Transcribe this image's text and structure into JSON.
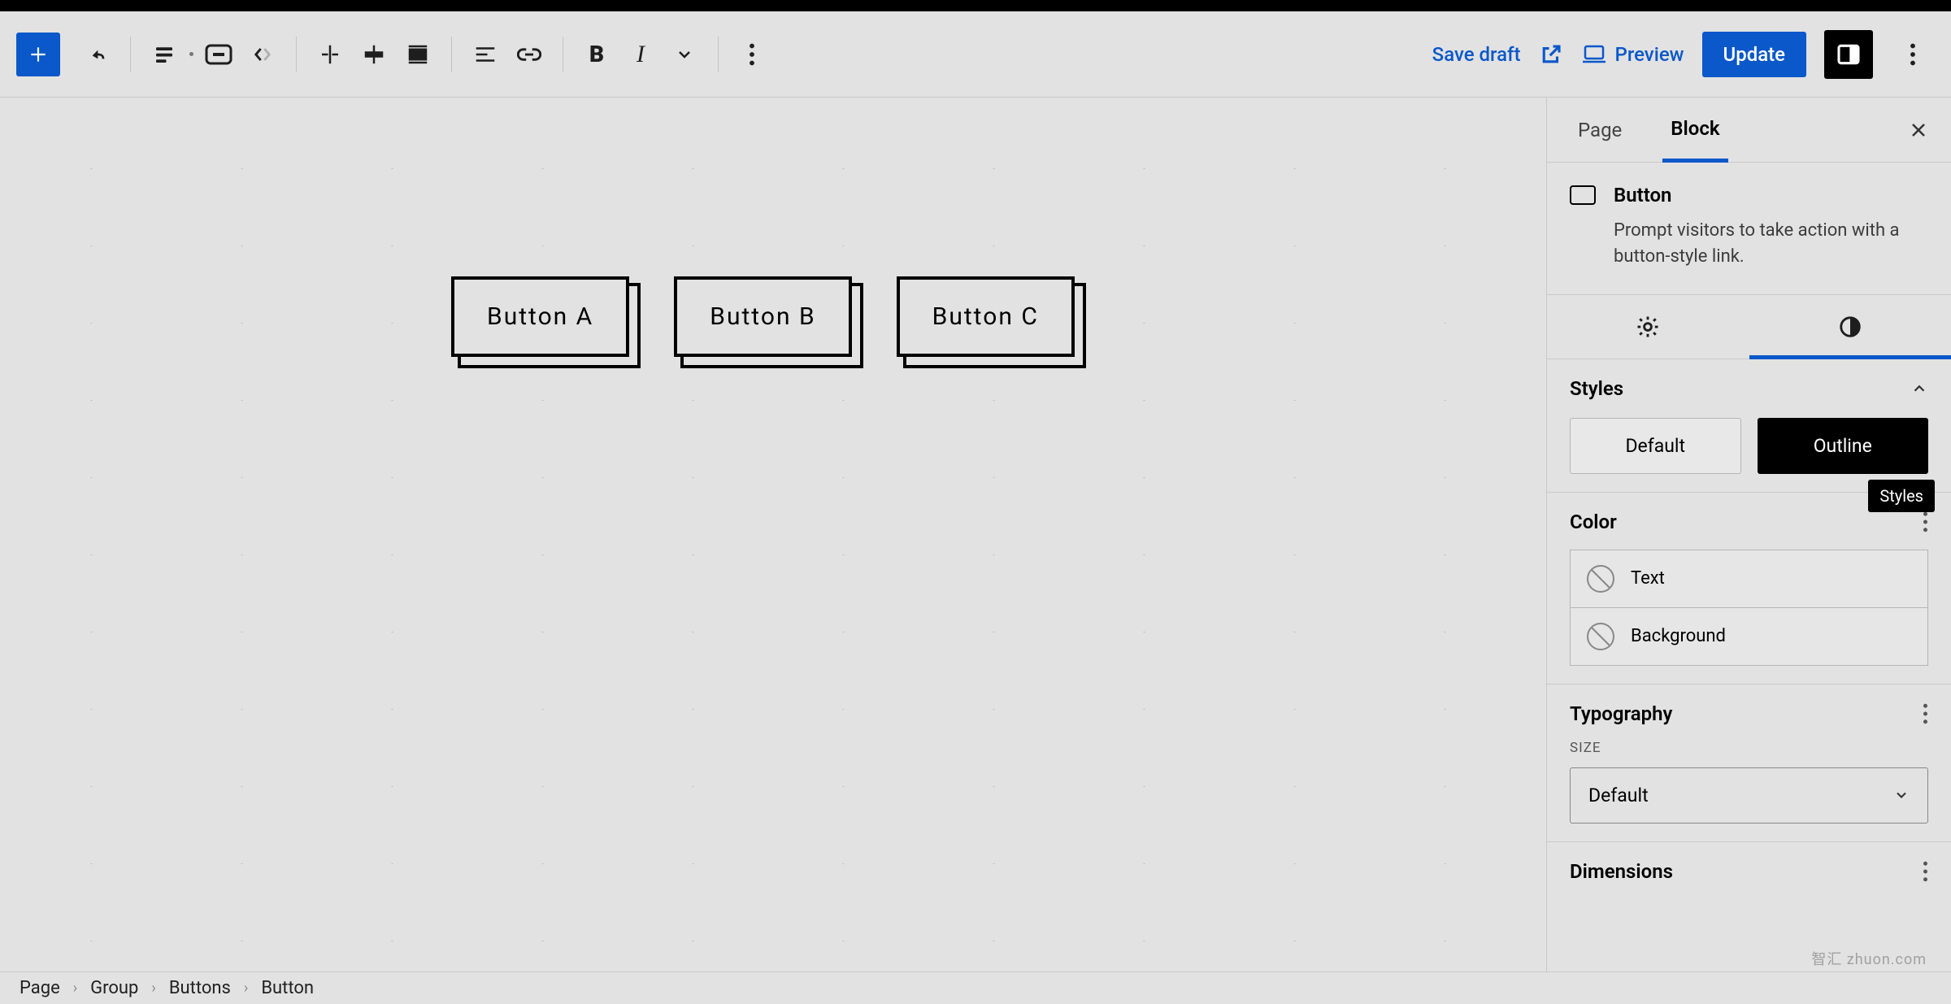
{
  "toolbar": {
    "save_draft": "Save draft",
    "preview": "Preview",
    "update": "Update"
  },
  "canvas": {
    "buttons": {
      "a": "Button A",
      "b": "Button B",
      "c": "Button C"
    }
  },
  "sidebar": {
    "tabs": {
      "page": "Page",
      "block": "Block"
    },
    "block": {
      "name": "Button",
      "description": "Prompt visitors to take action with a button-style link."
    },
    "tooltip": "Styles",
    "styles": {
      "heading": "Styles",
      "default": "Default",
      "outline": "Outline"
    },
    "color": {
      "heading": "Color",
      "text": "Text",
      "background": "Background"
    },
    "typography": {
      "heading": "Typography",
      "size_label": "SIZE",
      "size_value": "Default"
    },
    "dimensions": {
      "heading": "Dimensions"
    }
  },
  "breadcrumb": {
    "a": "Page",
    "b": "Group",
    "c": "Buttons",
    "d": "Button"
  },
  "watermark": "智汇 zhuon.com"
}
